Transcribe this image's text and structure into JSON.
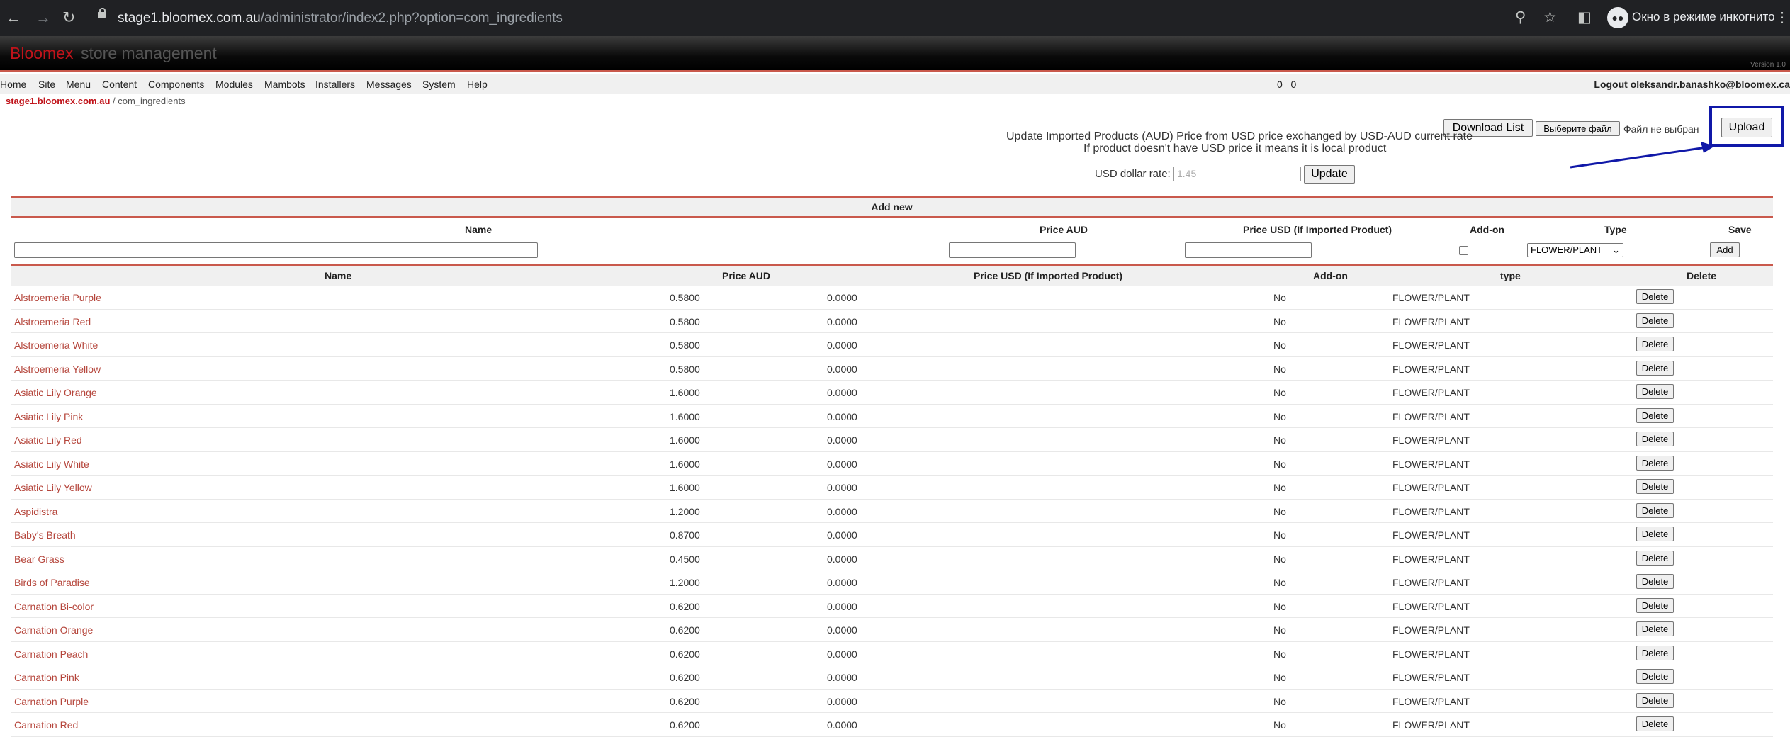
{
  "browser": {
    "url_domain": "stage1.bloomex.com.au",
    "url_path": "/administrator/index2.php?option=com_ingredients",
    "incognito_label": "Окно в режиме инкогнито"
  },
  "header": {
    "brand": "Bloomex",
    "subtitle": "store management",
    "version": "Version 1.0"
  },
  "menu": {
    "items": [
      "Home",
      "Site",
      "Menu",
      "Content",
      "Components",
      "Modules",
      "Mambots",
      "Installers",
      "Messages",
      "System",
      "Help"
    ],
    "count_a": "0",
    "count_b": "0",
    "logout": "Logout oleksandr.banashko@bloomex.ca"
  },
  "breadcrumb": {
    "site": "stage1.bloomex.com.au",
    "separator": " / ",
    "page": "com_ingredients"
  },
  "tools": {
    "download_label": "Download List",
    "choose_file_label": "Выберите файл",
    "no_file_label": "Файл не выбран",
    "upload_label": "Upload",
    "info_line1": "Update Imported Products (AUD) Price from USD price exchanged by USD-AUD current rate",
    "info_line2": "If product doesn't have USD price it means it is local product",
    "usd_rate_label": "USD dollar rate:",
    "usd_rate_placeholder": "1.45",
    "update_label": "Update"
  },
  "add_new": {
    "title": "Add new",
    "col_name": "Name",
    "col_price_aud": "Price AUD",
    "col_price_usd": "Price USD (If Imported Product)",
    "col_addon": "Add-on",
    "col_type": "Type",
    "col_save": "Save",
    "type_selected": "FLOWER/PLANT",
    "add_label": "Add"
  },
  "list": {
    "col_name": "Name",
    "col_price_aud": "Price AUD",
    "col_price_usd": "Price USD (If Imported Product)",
    "col_addon": "Add-on",
    "col_type": "type",
    "col_delete": "Delete",
    "delete_label": "Delete",
    "rows": [
      {
        "name": "Alstroemeria Purple",
        "aud": "0.5800",
        "usd": "0.0000",
        "addon": "No",
        "type": "FLOWER/PLANT"
      },
      {
        "name": "Alstroemeria Red",
        "aud": "0.5800",
        "usd": "0.0000",
        "addon": "No",
        "type": "FLOWER/PLANT"
      },
      {
        "name": "Alstroemeria White",
        "aud": "0.5800",
        "usd": "0.0000",
        "addon": "No",
        "type": "FLOWER/PLANT"
      },
      {
        "name": "Alstroemeria Yellow",
        "aud": "0.5800",
        "usd": "0.0000",
        "addon": "No",
        "type": "FLOWER/PLANT"
      },
      {
        "name": "Asiatic Lily Orange",
        "aud": "1.6000",
        "usd": "0.0000",
        "addon": "No",
        "type": "FLOWER/PLANT"
      },
      {
        "name": "Asiatic Lily Pink",
        "aud": "1.6000",
        "usd": "0.0000",
        "addon": "No",
        "type": "FLOWER/PLANT"
      },
      {
        "name": "Asiatic Lily Red",
        "aud": "1.6000",
        "usd": "0.0000",
        "addon": "No",
        "type": "FLOWER/PLANT"
      },
      {
        "name": "Asiatic Lily White",
        "aud": "1.6000",
        "usd": "0.0000",
        "addon": "No",
        "type": "FLOWER/PLANT"
      },
      {
        "name": "Asiatic Lily Yellow",
        "aud": "1.6000",
        "usd": "0.0000",
        "addon": "No",
        "type": "FLOWER/PLANT"
      },
      {
        "name": "Aspidistra",
        "aud": "1.2000",
        "usd": "0.0000",
        "addon": "No",
        "type": "FLOWER/PLANT"
      },
      {
        "name": "Baby's Breath",
        "aud": "0.8700",
        "usd": "0.0000",
        "addon": "No",
        "type": "FLOWER/PLANT"
      },
      {
        "name": "Bear Grass",
        "aud": "0.4500",
        "usd": "0.0000",
        "addon": "No",
        "type": "FLOWER/PLANT"
      },
      {
        "name": "Birds of Paradise",
        "aud": "1.2000",
        "usd": "0.0000",
        "addon": "No",
        "type": "FLOWER/PLANT"
      },
      {
        "name": "Carnation Bi-color",
        "aud": "0.6200",
        "usd": "0.0000",
        "addon": "No",
        "type": "FLOWER/PLANT"
      },
      {
        "name": "Carnation Orange",
        "aud": "0.6200",
        "usd": "0.0000",
        "addon": "No",
        "type": "FLOWER/PLANT"
      },
      {
        "name": "Carnation Peach",
        "aud": "0.6200",
        "usd": "0.0000",
        "addon": "No",
        "type": "FLOWER/PLANT"
      },
      {
        "name": "Carnation Pink",
        "aud": "0.6200",
        "usd": "0.0000",
        "addon": "No",
        "type": "FLOWER/PLANT"
      },
      {
        "name": "Carnation Purple",
        "aud": "0.6200",
        "usd": "0.0000",
        "addon": "No",
        "type": "FLOWER/PLANT"
      },
      {
        "name": "Carnation Red",
        "aud": "0.6200",
        "usd": "0.0000",
        "addon": "No",
        "type": "FLOWER/PLANT"
      }
    ]
  },
  "colors": {
    "brand_red": "#c0131a",
    "link_red": "#b5453b",
    "highlight_blue": "#1018a8"
  }
}
